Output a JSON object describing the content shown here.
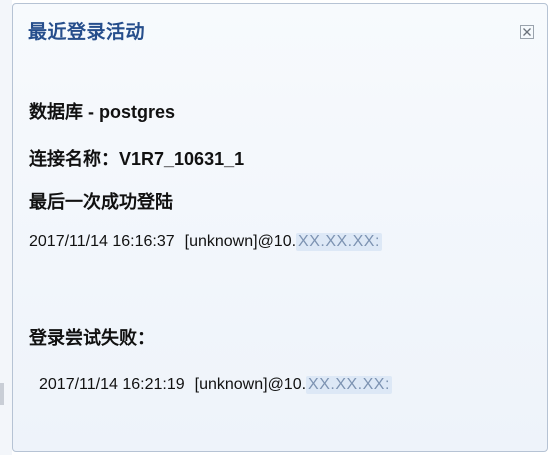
{
  "panel": {
    "title": "最近登录活动",
    "close_icon": "close-icon"
  },
  "database": {
    "text": "数据库 - postgres"
  },
  "connection": {
    "text": "连接名称：V1R7_10631_1"
  },
  "last_success": {
    "heading": "最后一次成功登陆",
    "timestamp": "2017/11/14 16:16:37",
    "user_host_prefix": "[unknown]@10.",
    "user_host_masked": "XX.XX.XX:"
  },
  "failed_attempts": {
    "heading": "登录尝试失败：",
    "timestamp": "2017/11/14 16:21:19",
    "user_host_prefix": "[unknown]@10.",
    "user_host_masked": "XX.XX.XX:"
  },
  "colors": {
    "title": "#264e8c",
    "panel_border": "#b6c3d4",
    "mask_bg": "#dde8f6"
  }
}
